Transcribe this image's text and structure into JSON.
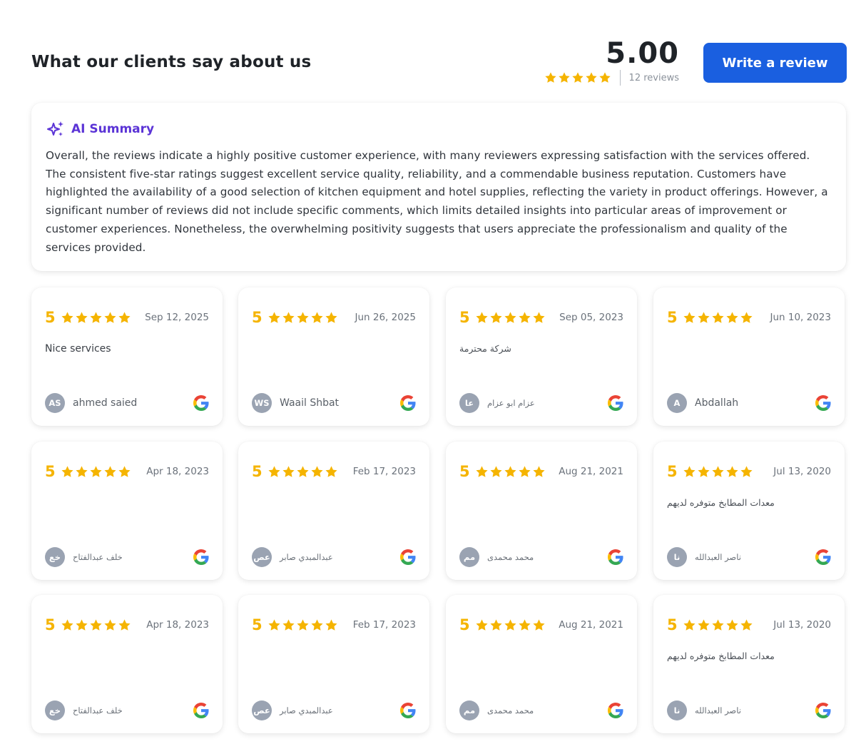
{
  "header": {
    "title": "What our clients say about us",
    "rating": "5.00",
    "stars": 5,
    "reviews_count": "12 reviews",
    "write_review_label": "Write a review"
  },
  "summary": {
    "title": "AI Summary",
    "text": "Overall, the reviews indicate a highly positive customer experience, with many reviewers expressing satisfaction with the services offered. The consistent five-star ratings suggest excellent service quality, reliability, and a commendable business reputation. Customers have highlighted the availability of a good selection of kitchen equipment and hotel supplies, reflecting the variety in product offerings. However, a significant number of reviews did not include specific comments, which limits detailed insights into particular areas of improvement or customer experiences. Nonetheless, the overwhelming positivity suggests that users appreciate the professionalism and quality of the services provided."
  },
  "colors": {
    "accent": "#1a5fe0",
    "star": "#f5b400",
    "summary_title": "#5b34d6",
    "avatar_bg": "#9aa3b2"
  },
  "reviews": [
    {
      "score": "5",
      "date": "Sep 12, 2025",
      "text": "Nice services",
      "initials": "AS",
      "name": "ahmed saied",
      "source_icon": "google-icon"
    },
    {
      "score": "5",
      "date": "Jun 26, 2025",
      "text": "",
      "initials": "WS",
      "name": "Waail Shbat",
      "source_icon": "google-icon"
    },
    {
      "score": "5",
      "date": "Sep 05, 2023",
      "text": "شركة محترمة",
      "initials": "عا",
      "name": "عزام ابو عزام",
      "source_icon": "google-icon"
    },
    {
      "score": "5",
      "date": "Jun 10, 2023",
      "text": "",
      "initials": "A",
      "name": "Abdallah",
      "source_icon": "google-icon"
    },
    {
      "score": "5",
      "date": "Apr 18, 2023",
      "text": "",
      "initials": "خع",
      "name": "خلف عبدالفتاح",
      "source_icon": "google-icon"
    },
    {
      "score": "5",
      "date": "Feb 17, 2023",
      "text": "",
      "initials": "عص",
      "name": "عبدالمبدي صابر",
      "source_icon": "google-icon"
    },
    {
      "score": "5",
      "date": "Aug 21, 2021",
      "text": "",
      "initials": "مم",
      "name": "محمد محمدى",
      "source_icon": "google-icon"
    },
    {
      "score": "5",
      "date": "Jul 13, 2020",
      "text": "معدات المطابخ متوفره لديهم",
      "initials": "نا",
      "name": "ناصر العبدالله",
      "source_icon": "google-icon"
    },
    {
      "score": "5",
      "date": "Apr 18, 2023",
      "text": "",
      "initials": "خع",
      "name": "خلف عبدالفتاح",
      "source_icon": "google-icon"
    },
    {
      "score": "5",
      "date": "Feb 17, 2023",
      "text": "",
      "initials": "عص",
      "name": "عبدالمبدي صابر",
      "source_icon": "google-icon"
    },
    {
      "score": "5",
      "date": "Aug 21, 2021",
      "text": "",
      "initials": "مم",
      "name": "محمد محمدى",
      "source_icon": "google-icon"
    },
    {
      "score": "5",
      "date": "Jul 13, 2020",
      "text": "معدات المطابخ متوفره لديهم",
      "initials": "نا",
      "name": "ناصر العبدالله",
      "source_icon": "google-icon"
    }
  ]
}
